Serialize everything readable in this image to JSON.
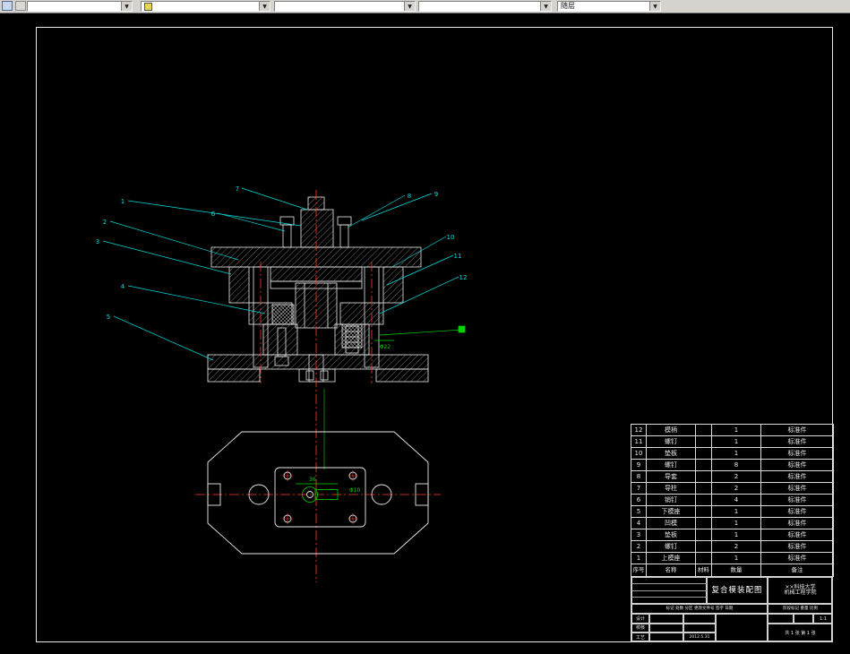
{
  "toolbar": {
    "combos": [
      {
        "value": ""
      },
      {
        "value": ""
      },
      {
        "value": ""
      },
      {
        "value": ""
      },
      {
        "value": "随层"
      }
    ]
  },
  "drawing": {
    "callouts": [
      "1",
      "2",
      "3",
      "4",
      "5",
      "6",
      "7",
      "8",
      "9",
      "10",
      "11",
      "12"
    ],
    "dims": {
      "section_dia": "Φ22",
      "plan_width": "36",
      "plan_hole": "Φ10"
    }
  },
  "bom": {
    "headers": {
      "seq": "序号",
      "name": "名称",
      "material": "材料",
      "qty": "数量",
      "remark": "备注"
    },
    "rows": [
      {
        "seq": "12",
        "name": "模柄",
        "material": "",
        "qty": "1",
        "remark": "标准件"
      },
      {
        "seq": "11",
        "name": "螺钉",
        "material": "",
        "qty": "1",
        "remark": "标准件"
      },
      {
        "seq": "10",
        "name": "垫板",
        "material": "",
        "qty": "1",
        "remark": "标准件"
      },
      {
        "seq": "9",
        "name": "螺钉",
        "material": "",
        "qty": "8",
        "remark": "标准件"
      },
      {
        "seq": "8",
        "name": "导套",
        "material": "",
        "qty": "2",
        "remark": "标准件"
      },
      {
        "seq": "7",
        "name": "导柱",
        "material": "",
        "qty": "2",
        "remark": "标准件"
      },
      {
        "seq": "6",
        "name": "销钉",
        "material": "",
        "qty": "4",
        "remark": "标准件"
      },
      {
        "seq": "5",
        "name": "下模座",
        "material": "",
        "qty": "1",
        "remark": "标准件"
      },
      {
        "seq": "4",
        "name": "凹模",
        "material": "",
        "qty": "1",
        "remark": "标准件"
      },
      {
        "seq": "3",
        "name": "垫板",
        "material": "",
        "qty": "1",
        "remark": "标准件"
      },
      {
        "seq": "2",
        "name": "螺钉",
        "material": "",
        "qty": "2",
        "remark": "标准件"
      },
      {
        "seq": "1",
        "name": "上模座",
        "material": "",
        "qty": "1",
        "remark": "标准件"
      }
    ]
  },
  "title_block": {
    "drawing_title": "复合模装配图",
    "org_line1": "××科技大学",
    "org_line2": "机械工程学院",
    "revision_header": "标记 处数 分区 更改文件号 签字 日期",
    "stage_header": "阶段标记 重量 比例",
    "role_design": "设计",
    "role_check": "校核",
    "role_craft": "工艺",
    "date": "2012.5.31",
    "scale": "1:1",
    "sheet": "共 1 张  第 1 张"
  },
  "colors": {
    "centerline_red": "#ff3b30",
    "leader_cyan": "#00dede",
    "dim_green": "#00d400",
    "entity_white": "#e9e9e9"
  }
}
